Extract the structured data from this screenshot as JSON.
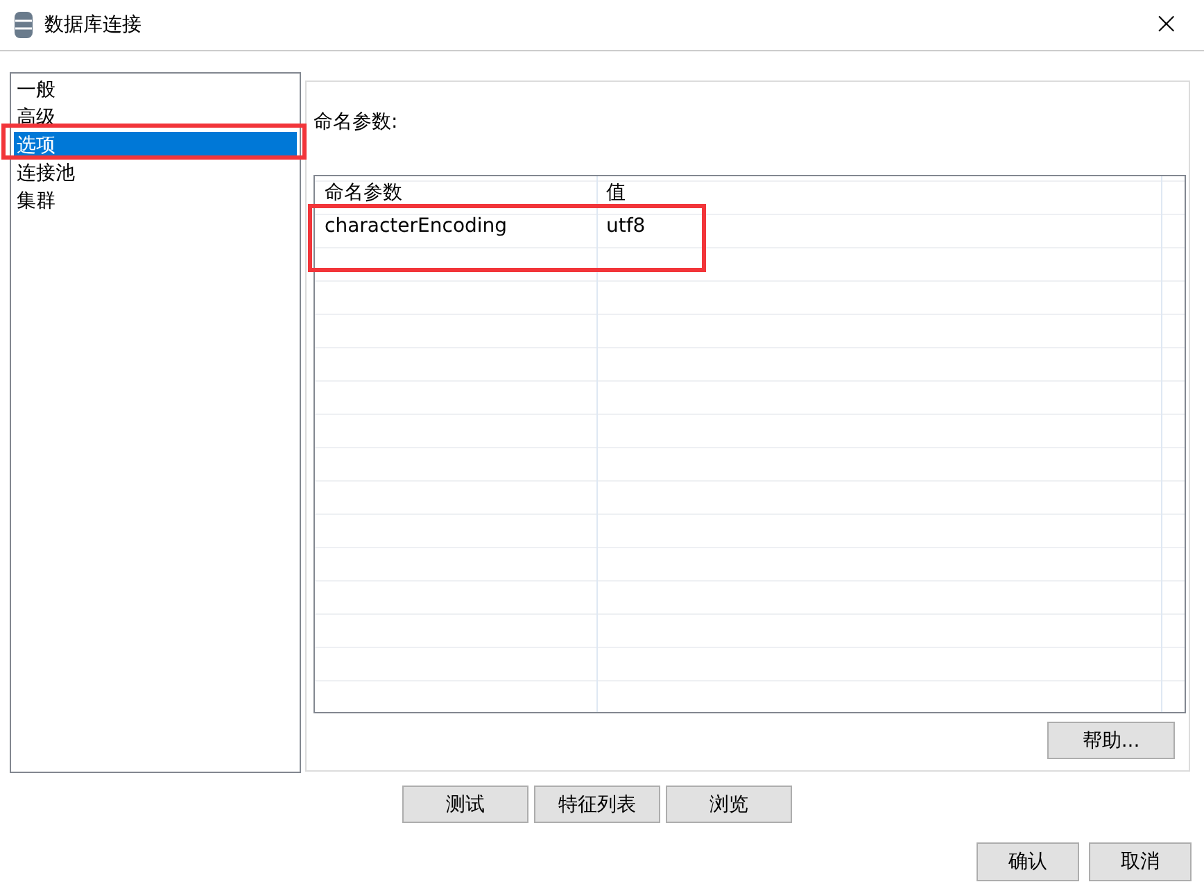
{
  "window": {
    "title": "数据库连接",
    "close": "×"
  },
  "sidebar": {
    "items": [
      {
        "label": "一般",
        "selected": false
      },
      {
        "label": "高级",
        "selected": false
      },
      {
        "label": "选项",
        "selected": true
      },
      {
        "label": "连接池",
        "selected": false
      },
      {
        "label": "集群",
        "selected": false
      }
    ]
  },
  "panel": {
    "label": "命名参数:",
    "table": {
      "columns": [
        "命名参数",
        "值"
      ],
      "rows": [
        {
          "name": "characterEncoding",
          "value": "utf8"
        }
      ]
    },
    "help_button": "帮助..."
  },
  "action_buttons": [
    "测试",
    "特征列表",
    "浏览"
  ],
  "dialog_buttons": [
    "确认",
    "取消"
  ]
}
